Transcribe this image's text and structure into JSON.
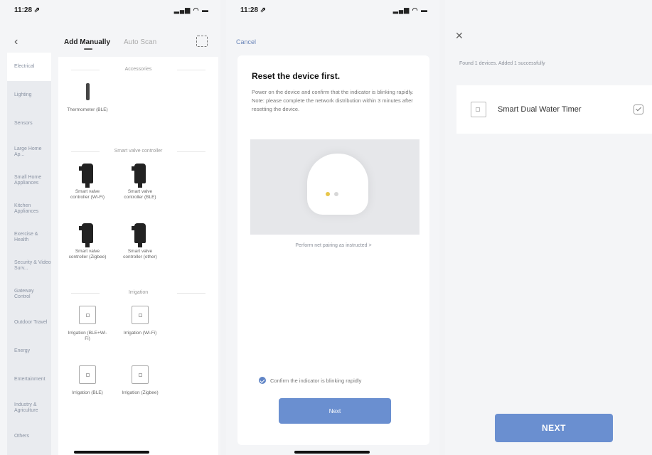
{
  "panel1": {
    "status": {
      "time": "11:28 ⇗",
      "icons": "▂▄▆ ◠ ▬"
    },
    "tabs": {
      "active": "Add Manually",
      "inactive": "Auto Scan"
    },
    "sidebar": [
      {
        "label": "Electrical"
      },
      {
        "label": "Lighting"
      },
      {
        "label": "Sensors"
      },
      {
        "label": "Large Home Ap..."
      },
      {
        "label": "Small Home Appliances"
      },
      {
        "label": "Kitchen Appliances"
      },
      {
        "label": "Exercise & Health"
      },
      {
        "label": "Security & Video Surv..."
      },
      {
        "label": "Gateway Control"
      },
      {
        "label": "Outdoor Travel"
      },
      {
        "label": "Energy"
      },
      {
        "label": "Entertainment"
      },
      {
        "label": "Industry & Agriculture"
      },
      {
        "label": "Others"
      }
    ],
    "sections": [
      {
        "title": "Accessories",
        "items": [
          {
            "label": "Thermometer (BLE)",
            "icon": "thin-device-icon"
          }
        ]
      },
      {
        "title": "Smart valve controller",
        "items": [
          {
            "label": "Smart valve controller (Wi-Fi)",
            "icon": "valve-icon"
          },
          {
            "label": "Smart valve controller (BLE)",
            "icon": "valve-icon"
          },
          {
            "label": "Smart valve controller (Zigbee)",
            "icon": "valve-icon"
          },
          {
            "label": "Smart valve controller (other)",
            "icon": "valve-icon"
          }
        ]
      },
      {
        "title": "Irrigation",
        "items": [
          {
            "label": "Irrigation (BLE+Wi-Fi)",
            "icon": "box-icon"
          },
          {
            "label": "Irrigation (Wi-Fi)",
            "icon": "box-icon"
          },
          {
            "label": "Irrigation (BLE)",
            "icon": "box-icon"
          },
          {
            "label": "Irrigation (Zigbee)",
            "icon": "box-icon"
          }
        ]
      }
    ]
  },
  "panel2": {
    "status": {
      "time": "11:28 ⇗",
      "icons": "▂▄▆ ◠ ▬"
    },
    "cancel": "Cancel",
    "title": "Reset the device first.",
    "description": "Power on the device and confirm that the indicator is blinking rapidly. Note: please complete the network distribution within 3 minutes after resetting the device.",
    "help_link": "Perform net pairing as instructed >",
    "confirm_text": "Confirm the indicator is blinking rapidly",
    "next_label": "Next"
  },
  "panel3": {
    "found_text": "Found 1 devices. Added 1 successfully",
    "device_name": "Smart Dual Water Timer",
    "next_label": "NEXT"
  }
}
